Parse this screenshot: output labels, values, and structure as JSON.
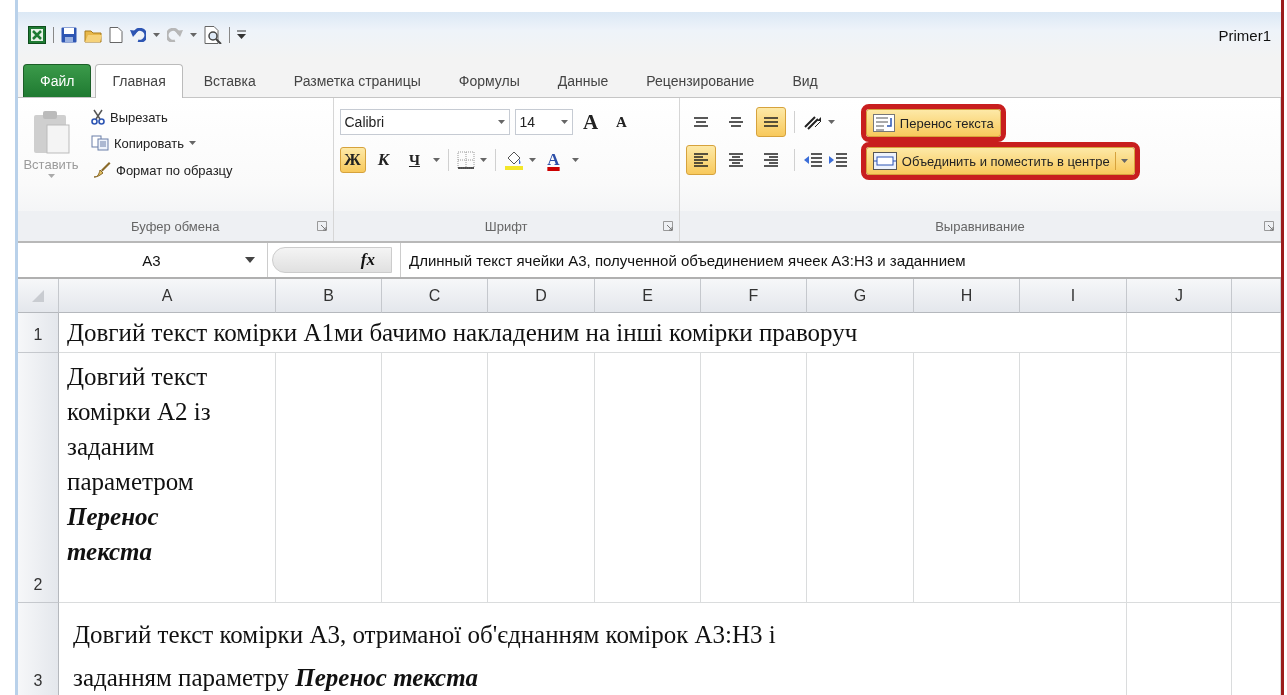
{
  "title_bar": {
    "title": "Primer1"
  },
  "tabs": [
    {
      "label": "Файл",
      "kind": "file",
      "selected": false
    },
    {
      "label": "Главная",
      "kind": "tab",
      "selected": true
    },
    {
      "label": "Вставка",
      "kind": "tab",
      "selected": false
    },
    {
      "label": "Разметка страницы",
      "kind": "tab",
      "selected": false
    },
    {
      "label": "Формулы",
      "kind": "tab",
      "selected": false
    },
    {
      "label": "Данные",
      "kind": "tab",
      "selected": false
    },
    {
      "label": "Рецензирование",
      "kind": "tab",
      "selected": false
    },
    {
      "label": "Вид",
      "kind": "tab",
      "selected": false
    }
  ],
  "clipboard": {
    "label": "Буфер обмена",
    "paste": {
      "label": "Вставить",
      "disabled": true
    },
    "items": [
      {
        "label": "Вырезать",
        "kind": "cut",
        "dropdown": false
      },
      {
        "label": "Копировать",
        "kind": "copy",
        "dropdown": true
      },
      {
        "label": "Формат по образцу",
        "kind": "painter",
        "dropdown": false
      }
    ]
  },
  "font": {
    "label": "Шрифт",
    "name": "Calibri",
    "size": "14",
    "grow_glyph": "A",
    "shrink_glyph": "A",
    "styles": [
      {
        "glyph": "Ж",
        "kind": "bold",
        "selected": true
      },
      {
        "glyph": "К",
        "kind": "italic",
        "selected": false
      },
      {
        "glyph": "Ч",
        "kind": "underline",
        "selected": false
      }
    ],
    "font_color_glyph": "A"
  },
  "alignment": {
    "label": "Выравнивание",
    "vertical": [
      {
        "kind": "top",
        "selected": false
      },
      {
        "kind": "middle",
        "selected": false
      },
      {
        "kind": "bottom",
        "selected": true
      }
    ],
    "horizontal": [
      {
        "kind": "left",
        "selected": true
      },
      {
        "kind": "center",
        "selected": false
      },
      {
        "kind": "right",
        "selected": false
      }
    ],
    "wrap_text": {
      "label": "Перенос текста",
      "highlighted": true
    },
    "merge": {
      "label": "Объединить и поместить в центре",
      "highlighted": true
    }
  },
  "formula_bar": {
    "cell": "A3",
    "function_glyph": "fx",
    "value": "Длинный текст ячейки А3, полученной объединением ячеек А3:Н3 и заданнием"
  },
  "sheet": {
    "columns": [
      "A",
      "B",
      "C",
      "D",
      "E",
      "F",
      "G",
      "H",
      "I",
      "J"
    ],
    "rows": [
      {
        "number": "1",
        "kind": "overflow",
        "text": "Довгий текст комірки А1ми бачимо накладеним на інші комірки праворуч"
      },
      {
        "number": "2",
        "kind": "wrapped",
        "text": "Довгий текст комірки А2 із заданим параметром **Перенос текста**"
      },
      {
        "number": "3",
        "kind": "merged",
        "text": "Довгий текст комірки А3, отриманої об'єднанням комірок А3:Н3 і заданням параметру **Перенос текста**"
      }
    ]
  }
}
